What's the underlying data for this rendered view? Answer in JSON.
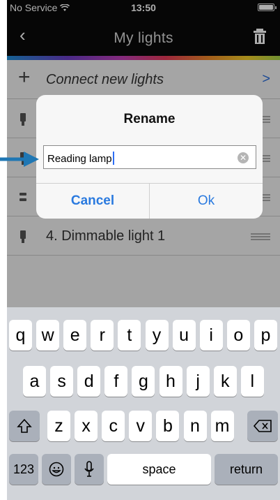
{
  "status_bar": {
    "carrier": "No Service",
    "time": "13:50"
  },
  "nav": {
    "title": "My lights",
    "back_icon": "‹"
  },
  "list": {
    "connect_label": "Connect new lights",
    "rows": [
      "4. Dimmable light 1"
    ]
  },
  "dialog": {
    "title": "Rename",
    "input_value": "Reading lamp",
    "cancel_label": "Cancel",
    "ok_label": "Ok"
  },
  "keyboard": {
    "row1": [
      "q",
      "w",
      "e",
      "r",
      "t",
      "y",
      "u",
      "i",
      "o",
      "p"
    ],
    "row2": [
      "a",
      "s",
      "d",
      "f",
      "g",
      "h",
      "j",
      "k",
      "l"
    ],
    "row3": [
      "z",
      "x",
      "c",
      "v",
      "b",
      "n",
      "m"
    ],
    "numbers_label": "123",
    "space_label": "space",
    "return_label": "return"
  },
  "colors": {
    "accent": "#2a7adf",
    "annotation_arrow": "#1f77b4"
  }
}
